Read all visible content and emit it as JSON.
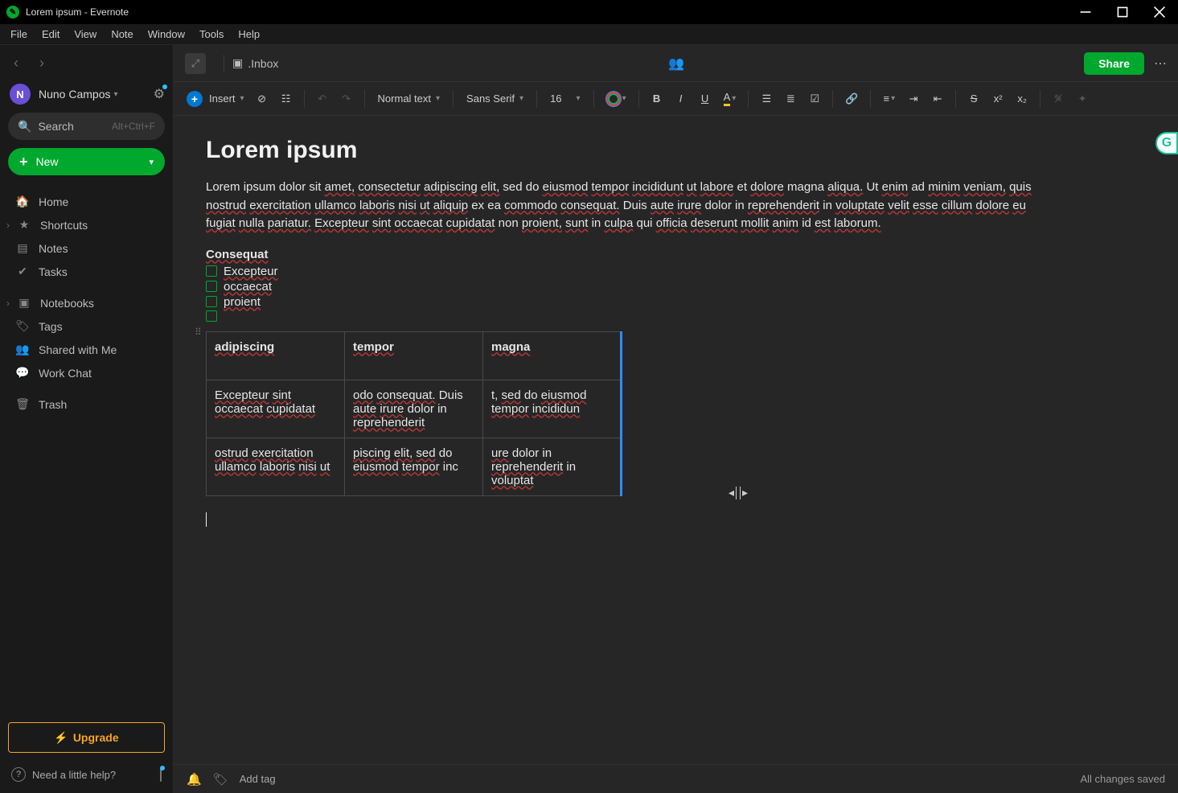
{
  "window": {
    "title": "Lorem ipsum - Evernote"
  },
  "menu": {
    "items": [
      "File",
      "Edit",
      "View",
      "Note",
      "Window",
      "Tools",
      "Help"
    ]
  },
  "sidebar": {
    "user": {
      "initial": "N",
      "name": "Nuno Campos"
    },
    "search": {
      "label": "Search",
      "hint": "Alt+Ctrl+F"
    },
    "new_label": "New",
    "items": [
      {
        "icon": "home",
        "label": "Home"
      },
      {
        "icon": "star",
        "label": "Shortcuts"
      },
      {
        "icon": "note",
        "label": "Notes"
      },
      {
        "icon": "check",
        "label": "Tasks"
      },
      {
        "icon": "book",
        "label": "Notebooks"
      },
      {
        "icon": "tag",
        "label": "Tags"
      },
      {
        "icon": "people",
        "label": "Shared with Me"
      },
      {
        "icon": "chat",
        "label": "Work Chat"
      },
      {
        "icon": "trash",
        "label": "Trash"
      }
    ],
    "upgrade": "Upgrade",
    "help": "Need a little help?"
  },
  "header": {
    "notebook": ".Inbox",
    "share": "Share"
  },
  "toolbar": {
    "insert": "Insert",
    "style": "Normal text",
    "font": "Sans Serif",
    "size": "16"
  },
  "note": {
    "title": "Lorem ipsum",
    "body": "Lorem ipsum dolor sit amet, consectetur adipiscing elit, sed do eiusmod tempor incididunt ut labore et dolore magna aliqua. Ut enim ad minim veniam, quis nostrud exercitation ullamco laboris nisi ut aliquip ex ea commodo consequat. Duis aute irure dolor in reprehenderit in voluptate velit esse cillum dolore eu fugiat nulla pariatur. Excepteur sint occaecat cupidatat non proient, sunt in culpa qui officia deserunt mollit anim id est laborum.",
    "sub_heading": "Consequat",
    "checks": [
      "Excepteur",
      "occaecat",
      "proient"
    ],
    "table": {
      "headers": [
        "adipiscing",
        "tempor",
        "magna"
      ],
      "rows": [
        [
          "Excepteur sint occaecat cupidatat",
          "odo consequat. Duis aute irure dolor in reprehenderit",
          "t, sed do eiusmod tempor incididun"
        ],
        [
          "ostrud exercitation ullamco laboris nisi ut",
          "piscing elit, sed do eiusmod tempor inc",
          "ure dolor in reprehenderit in voluptat"
        ]
      ]
    }
  },
  "footer": {
    "add_tag": "Add tag",
    "status": "All changes saved"
  }
}
